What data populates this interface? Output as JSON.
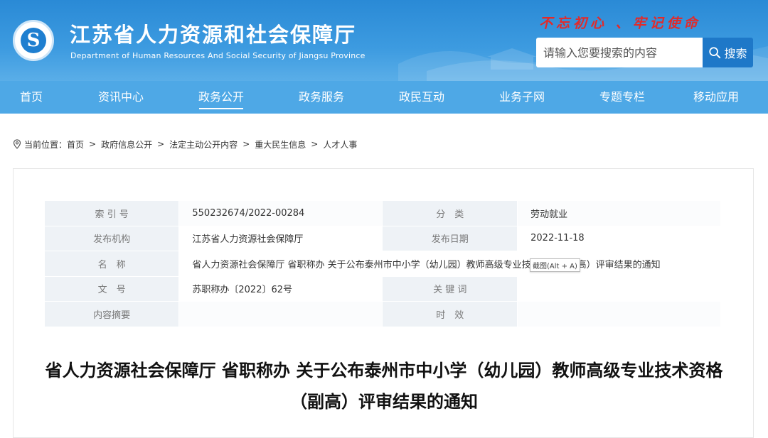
{
  "header": {
    "title": "江苏省人力资源和社会保障厅",
    "subtitle": "Department of Human Resources And Social Security of Jiangsu Province",
    "slogan": "不忘初心 、牢记使命",
    "logo_icon": "hrss-logo-icon",
    "search": {
      "placeholder": "请输入您要搜索的内容",
      "value": "",
      "button_label": "搜索"
    }
  },
  "nav": {
    "items": [
      {
        "label": "首页"
      },
      {
        "label": "资讯中心"
      },
      {
        "label": "政务公开"
      },
      {
        "label": "政务服务"
      },
      {
        "label": "政民互动"
      },
      {
        "label": "业务子网"
      },
      {
        "label": "专题专栏"
      },
      {
        "label": "移动应用"
      }
    ],
    "active_index": 2
  },
  "breadcrumb": {
    "prefix": "当前位置：",
    "items": [
      "首页",
      "政府信息公开",
      "法定主动公开内容",
      "重大民生信息",
      "人才人事"
    ]
  },
  "meta": {
    "index_label": "索 引 号",
    "index_value": "550232674/2022-00284",
    "category_label": "分　类",
    "category_value": "劳动就业",
    "publisher_label": "发布机构",
    "publisher_value": "江苏省人力资源社会保障厅",
    "date_label": "发布日期",
    "date_value": "2022-11-18",
    "name_label": "名　称",
    "name_value": "省人力资源社会保障厅 省职称办 关于公布泰州市中小学（幼儿园）教师高级专业技术资格（副高）评审结果的通知",
    "docno_label": "文　号",
    "docno_value": "苏职称办〔2022〕62号",
    "keywords_label": "关 键 词",
    "keywords_value": "",
    "summary_label": "内容摘要",
    "summary_value": "",
    "validity_label": "时　效",
    "validity_value": ""
  },
  "tooltip": "截图(Alt + A)",
  "article": {
    "title": "省人力资源社会保障厅 省职称办 关于公布泰州市中小学（幼儿园）教师高级专业技术资格（副高）评审结果的通知"
  }
}
